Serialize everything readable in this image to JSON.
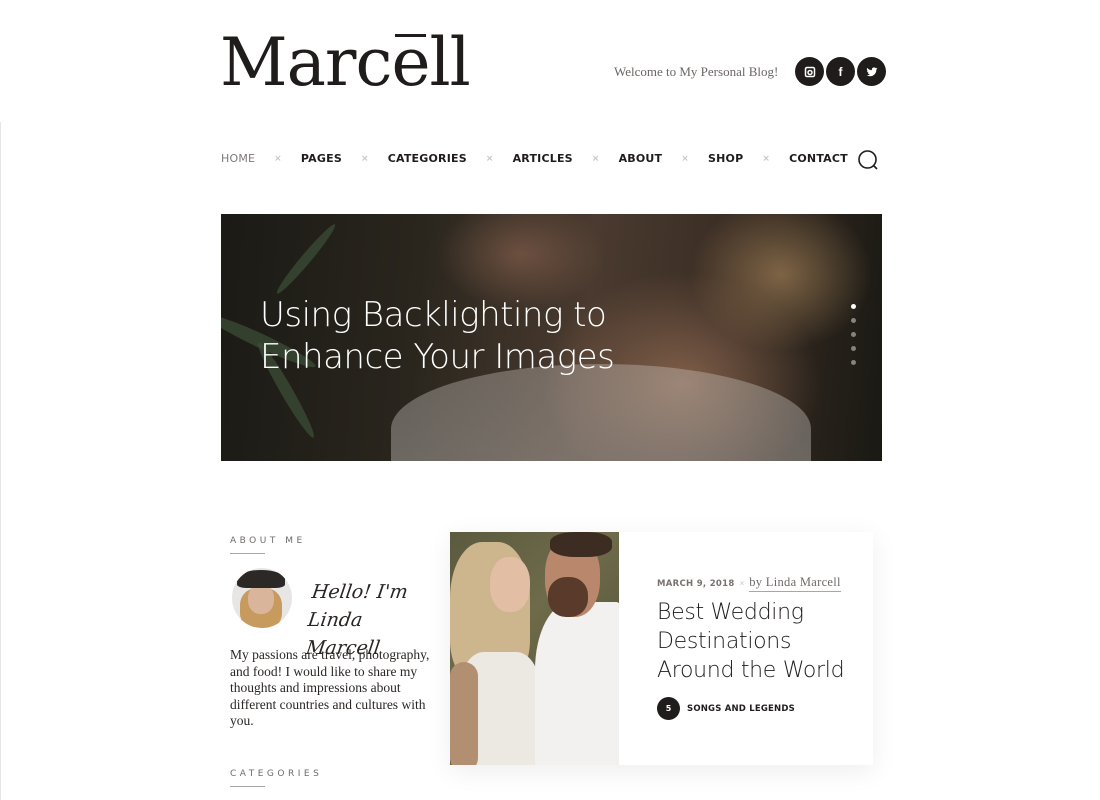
{
  "header": {
    "logo": "Marcēll",
    "logo_parts": {
      "pre": "Marc",
      "macron_letter": "e",
      "post": "ll"
    },
    "tagline": "Welcome to My Personal Blog!",
    "socials": [
      {
        "name": "instagram",
        "icon": "instagram-icon"
      },
      {
        "name": "facebook",
        "icon": "facebook-icon",
        "glyph": "f"
      },
      {
        "name": "twitter",
        "icon": "twitter-icon"
      }
    ]
  },
  "nav": {
    "items": [
      {
        "label": "HOME",
        "active": true
      },
      {
        "label": "PAGES"
      },
      {
        "label": "CATEGORIES"
      },
      {
        "label": "ARTICLES"
      },
      {
        "label": "ABOUT"
      },
      {
        "label": "SHOP"
      },
      {
        "label": "CONTACT"
      }
    ],
    "separator": "×",
    "search_icon": "search-icon"
  },
  "hero": {
    "title_line1": "Using Backlighting to",
    "title_line2": "Enhance Your Images",
    "slides_count": 5,
    "active_slide": 1
  },
  "sidebar": {
    "about_title": "ABOUT ME",
    "signature_line1": "Hello! I'm Linda",
    "signature_line2": "Marcell",
    "about_text": "My passions are travel, photography, and food! I would like to share my thoughts and impressions about different countries and cultures with you.",
    "categories_title": "CATEGORIES"
  },
  "featured_post": {
    "date": "MARCH 9, 2018",
    "separator": "×",
    "author": "by Linda Marcell",
    "title": "Best Wedding Destinations Around the World",
    "category_count": "5",
    "category_label": "SONGS AND LEGENDS"
  }
}
